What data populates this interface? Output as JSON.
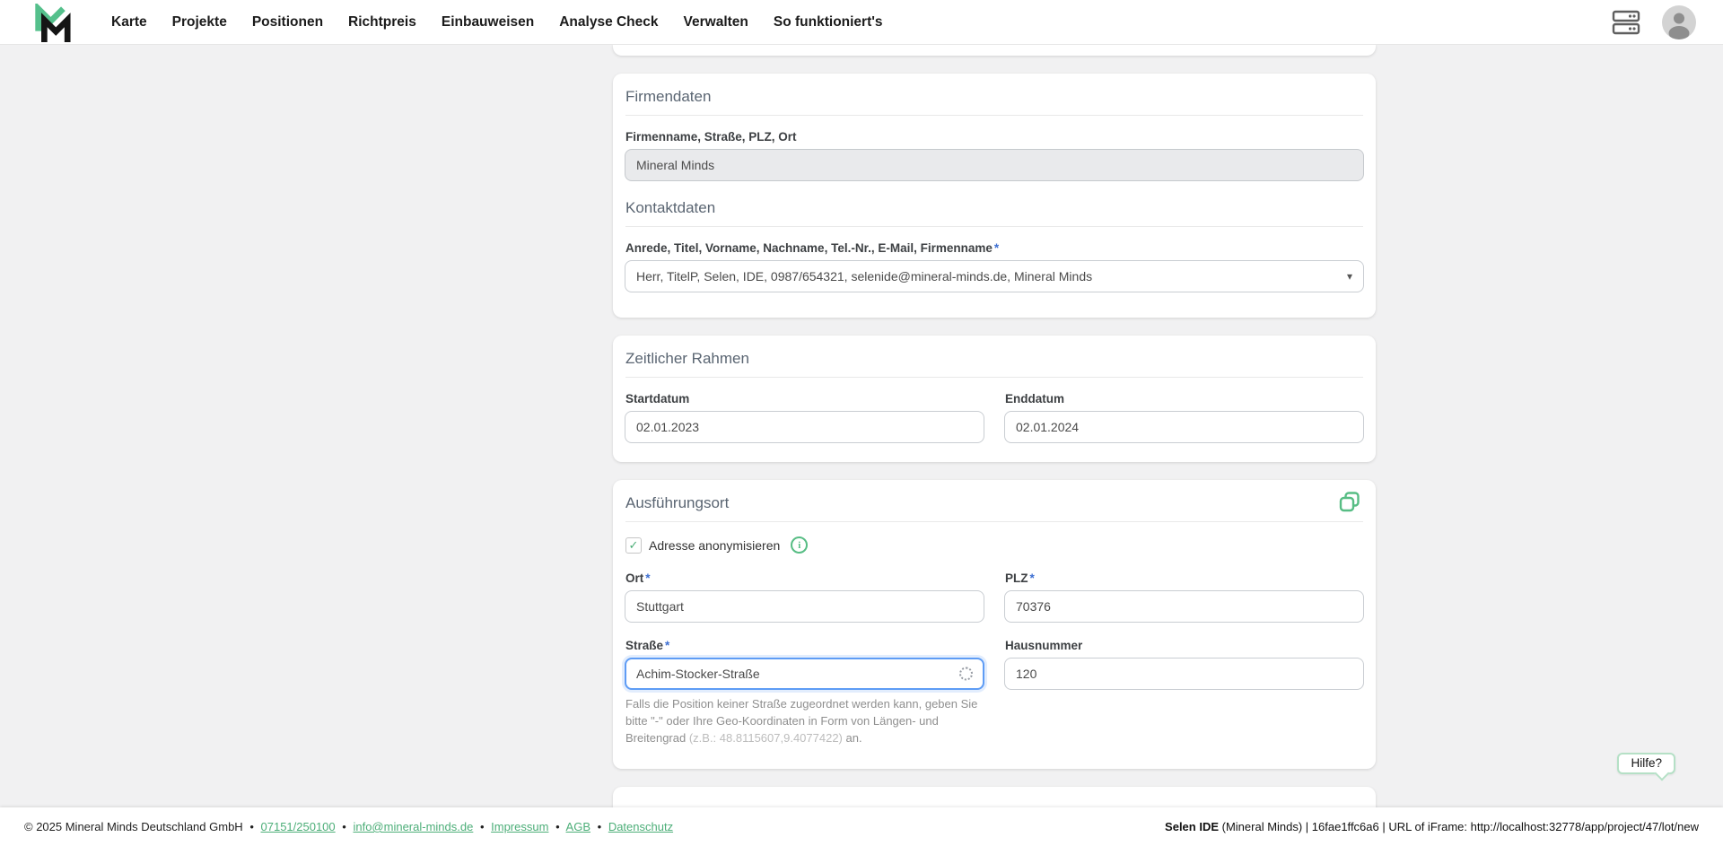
{
  "required_marker": "*",
  "icons": {
    "check": "✓",
    "info": "i",
    "caret": "▾"
  },
  "colors": {
    "brand_green": "#55c08c",
    "link_green": "#4cae78",
    "required_blue": "#3d6fd2",
    "focus_blue": "#5e9cf5",
    "page_background": "#f1f1f2"
  },
  "nav": {
    "items": [
      "Karte",
      "Projekte",
      "Positionen",
      "Richtpreis",
      "Einbauweisen",
      "Analyse Check",
      "Verwalten",
      "So funktioniert's"
    ]
  },
  "firmendaten": {
    "title": "Firmendaten",
    "company_label": "Firmenname, Straße, PLZ, Ort",
    "company_value": "Mineral Minds",
    "kontakt_title": "Kontaktdaten",
    "kontakt_label": "Anrede, Titel, Vorname, Nachname, Tel.-Nr., E-Mail, Firmenname",
    "kontakt_value": "Herr, TitelP, Selen, IDE, 0987/654321, selenide@mineral-minds.de, Mineral Minds"
  },
  "zeitlicher_rahmen": {
    "title": "Zeitlicher Rahmen",
    "startdatum_label": "Startdatum",
    "startdatum_value": "02.01.2023",
    "enddatum_label": "Enddatum",
    "enddatum_value": "02.01.2024"
  },
  "ausfuehrungsort": {
    "title": "Ausführungsort",
    "anonymisieren_label": "Adresse anonymisieren",
    "anonymisieren_checked": true,
    "ort_label": "Ort",
    "ort_value": "Stuttgart",
    "plz_label": "PLZ",
    "plz_value": "70376",
    "strasse_label": "Straße",
    "strasse_value": "Achim-Stocker-Straße",
    "hausnummer_label": "Hausnummer",
    "hausnummer_value": "120",
    "hinweis_part1": "Falls die Position keiner Straße zugeordnet werden kann, geben Sie bitte \"-\" oder Ihre Geo-Koordinaten in Form von Längen- und Breitengrad ",
    "hinweis_beispiel": "(z.B.: 48.8115607,9.4077422)",
    "hinweis_part2": " an."
  },
  "footer": {
    "copyright": "© 2025 Mineral Minds Deutschland GmbH",
    "separator": "•",
    "links": [
      "07151/250100",
      "info@mineral-minds.de",
      "Impressum",
      "AGB",
      "Datenschutz"
    ],
    "debug_app": "Selen IDE",
    "debug_info": " (Mineral Minds) | 16fae1ffc6a6 | URL of iFrame: http://localhost:32778/app/project/47/lot/new"
  },
  "help_button": {
    "label": "Hilfe?"
  }
}
